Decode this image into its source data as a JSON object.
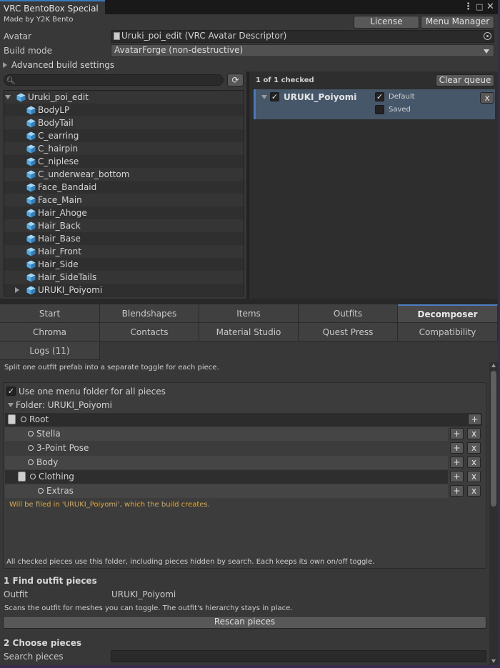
{
  "window": {
    "tab_title": "VRC BentoBox Special",
    "menu_icon": "kebab-menu-icon",
    "close_icon": "close-icon"
  },
  "header": {
    "credit": "Made by Y2K Bento",
    "license_button": "License",
    "menu_manager_button": "Menu Manager"
  },
  "fields": {
    "avatar_label": "Avatar",
    "avatar_value": "Uruki_poi_edit (VRC Avatar Descriptor)",
    "build_mode_label": "Build mode",
    "build_mode_value": "AvatarForge (non-destructive)",
    "advanced_label": "Advanced build settings"
  },
  "hierarchy": {
    "search_placeholder": "",
    "root": "Uruki_poi_edit",
    "items": [
      "BodyLP",
      "BodyTail",
      "C_earring",
      "C_hairpin",
      "C_niplese",
      "C_underwear_bottom",
      "Face_Bandaid",
      "Face_Main",
      "Hair_Ahoge",
      "Hair_Back",
      "Hair_Base",
      "Hair_Front",
      "Hair_Side",
      "Hair_SideTails",
      "URUKI_Poiyomi"
    ]
  },
  "queue": {
    "status": "1 of 1 checked",
    "clear_button": "Clear queue",
    "item_name": "URUKI_Poiyomi",
    "option_default": "Default",
    "option_saved": "Saved",
    "remove_button": "x"
  },
  "tabs": {
    "row1": [
      "Start",
      "Blendshapes",
      "Items",
      "Outfits",
      "Decomposer"
    ],
    "row2": [
      "Chroma",
      "Contacts",
      "Material Studio",
      "Quest Press",
      "Compatibility"
    ],
    "row3": [
      "Logs (11)"
    ],
    "selected": "Decomposer"
  },
  "decomposer": {
    "description": "Split one outfit prefab into a separate toggle for each piece.",
    "use_one_folder": "Use one menu folder for all pieces",
    "folder_label": "Folder: URUKI_Poiyomi",
    "pieces": [
      {
        "label": "Root"
      },
      {
        "label": "Stella"
      },
      {
        "label": "3-Point Pose"
      },
      {
        "label": "Body"
      },
      {
        "label": "Clothing"
      },
      {
        "label": "Extras"
      }
    ],
    "warning": "Will be filed in 'URUKI_Poiyomi', which the build creates.",
    "footnote": "All checked pieces use this folder, including pieces hidden by search. Each keeps its own on/off toggle.",
    "step1_title": "1  Find outfit pieces",
    "outfit_label": "Outfit",
    "outfit_value": "URUKI_Poiyomi",
    "scan_note": "Scans the outfit for meshes you can toggle. The outfit's hierarchy stays in place.",
    "rescan_button": "Rescan pieces",
    "step2_title": "2  Choose pieces",
    "search_label": "Search pieces",
    "search_value": ""
  },
  "colors": {
    "accent": "#3d7ad1",
    "warning": "#d9a84a",
    "panel": "#383838"
  }
}
